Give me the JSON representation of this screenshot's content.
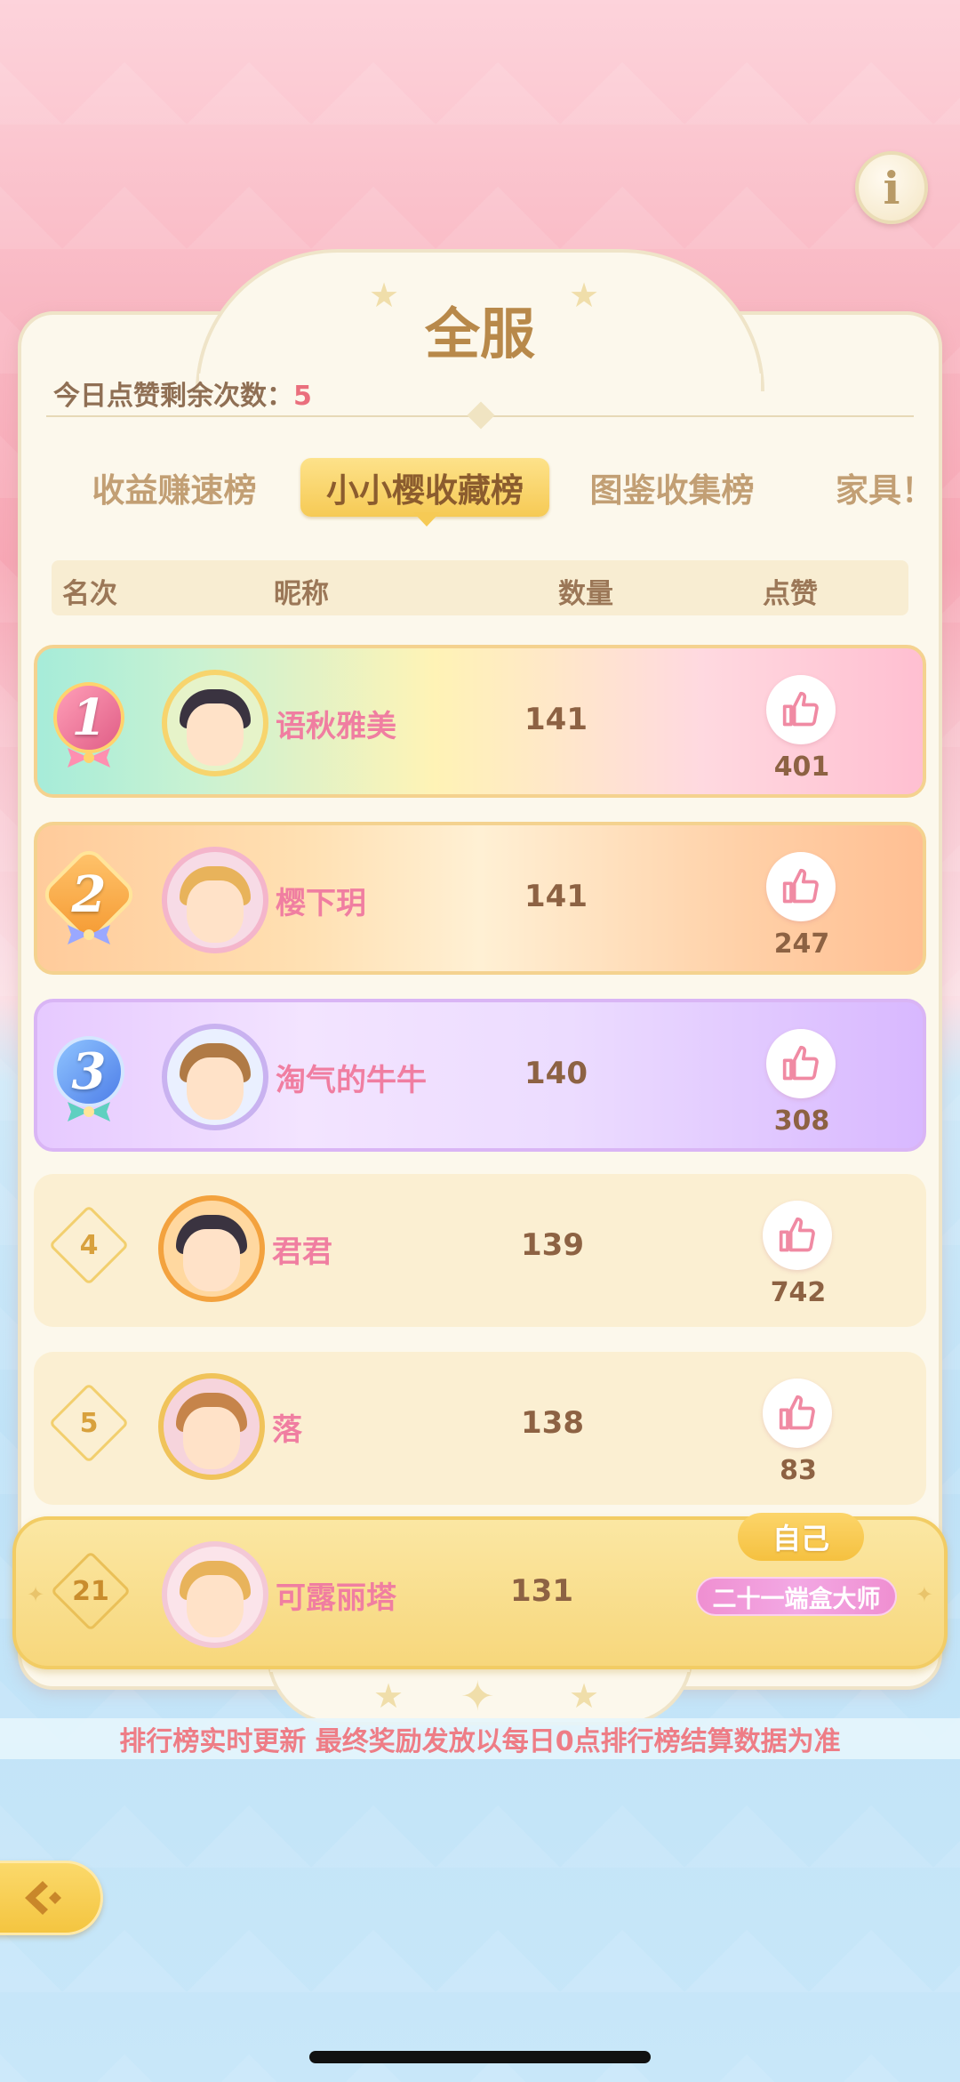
{
  "header": {
    "title": "全服",
    "likes_remaining_label": "今日点赞剩余次数：",
    "likes_remaining_value": "5"
  },
  "tabs": [
    {
      "label": "收益赚速榜",
      "active": false
    },
    {
      "label": "小小樱收藏榜",
      "active": true
    },
    {
      "label": "图鉴收集榜",
      "active": false
    },
    {
      "label": "家具！",
      "active": false
    }
  ],
  "columns": {
    "rank": "名次",
    "nickname": "昵称",
    "quantity": "数量",
    "likes": "点赞"
  },
  "rows": [
    {
      "rank": "1",
      "name": "语秋雅美",
      "count": "141",
      "likes": "401"
    },
    {
      "rank": "2",
      "name": "樱下玥",
      "count": "141",
      "likes": "247"
    },
    {
      "rank": "3",
      "name": "淘气的牛牛",
      "count": "140",
      "likes": "308"
    },
    {
      "rank": "4",
      "name": "君君",
      "count": "139",
      "likes": "742"
    },
    {
      "rank": "5",
      "name": "落",
      "count": "138",
      "likes": "83"
    }
  ],
  "self": {
    "badge": "自己",
    "rank": "21",
    "name": "可露丽塔",
    "count": "131",
    "title": "二十一端盒大师"
  },
  "footer": {
    "notice": "排行榜实时更新 最终奖励发放以每日0点排行榜结算数据为准"
  },
  "colors": {
    "accent_gold": "#f6ca55",
    "name_pink": "#f07ea1",
    "count_brown": "#8d6243"
  }
}
